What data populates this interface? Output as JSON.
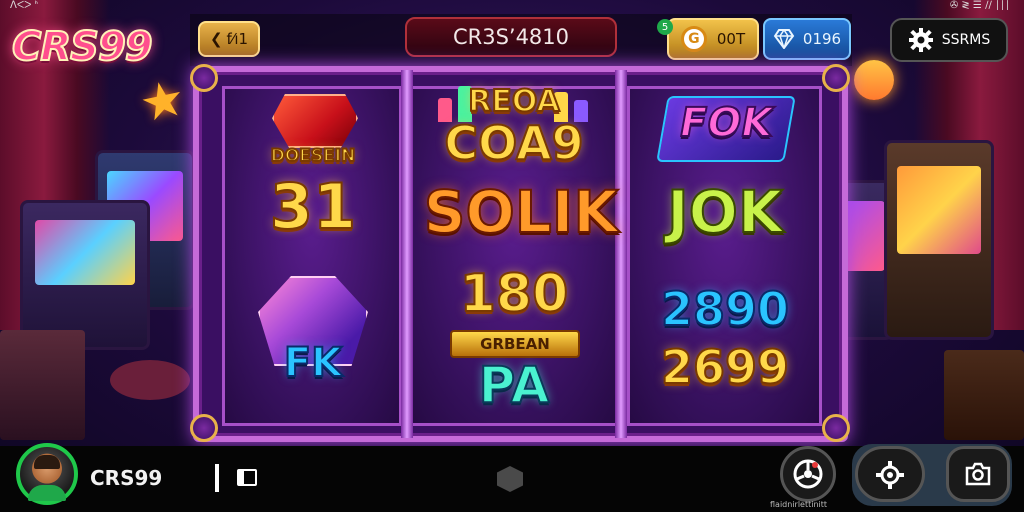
{
  "status_bar": {
    "left": "ᐱᐸᐳ ᑋ",
    "right": "✇ ≷ ☰ ∕∕ ∣∣∣"
  },
  "logo": "CRS99",
  "top_hud": {
    "back_label": "f⁄ı1",
    "title": "CR3S’4810",
    "coins": {
      "badge": "5",
      "icon_glyph": "G",
      "value": "00T"
    },
    "gems": {
      "value": "0196"
    },
    "settings_label": "SSRMS"
  },
  "reels": [
    {
      "symbols": [
        {
          "label": "DOESEIN",
          "style": "gold"
        },
        {
          "label": "31",
          "style": "gold"
        },
        {
          "label": "FK",
          "style": "blue"
        }
      ]
    },
    {
      "symbols": [
        {
          "label": "REOA",
          "style": "gold"
        },
        {
          "label": "COA9",
          "style": "gold"
        },
        {
          "label": "SOLIK",
          "style": "orange"
        },
        {
          "label": "180",
          "style": "gold"
        },
        {
          "label": "GRBEAN",
          "style": "plaque"
        },
        {
          "label": "PA",
          "style": "teal"
        }
      ]
    },
    {
      "symbols": [
        {
          "label": "FOK",
          "style": "pink"
        },
        {
          "label": "JOK",
          "style": "green"
        },
        {
          "label": "2890",
          "style": "blue"
        },
        {
          "label": "2699",
          "style": "gold"
        }
      ]
    }
  ],
  "bottom_bar": {
    "username": "CRS99",
    "caption": "flaidnirlettinitt"
  },
  "colors": {
    "logo": "#ff4e8e",
    "frame": "#c56ad8",
    "avatar_ring": "#1fc84a",
    "gold_button": "#e8b24a",
    "blue_button": "#2a7ad8"
  }
}
